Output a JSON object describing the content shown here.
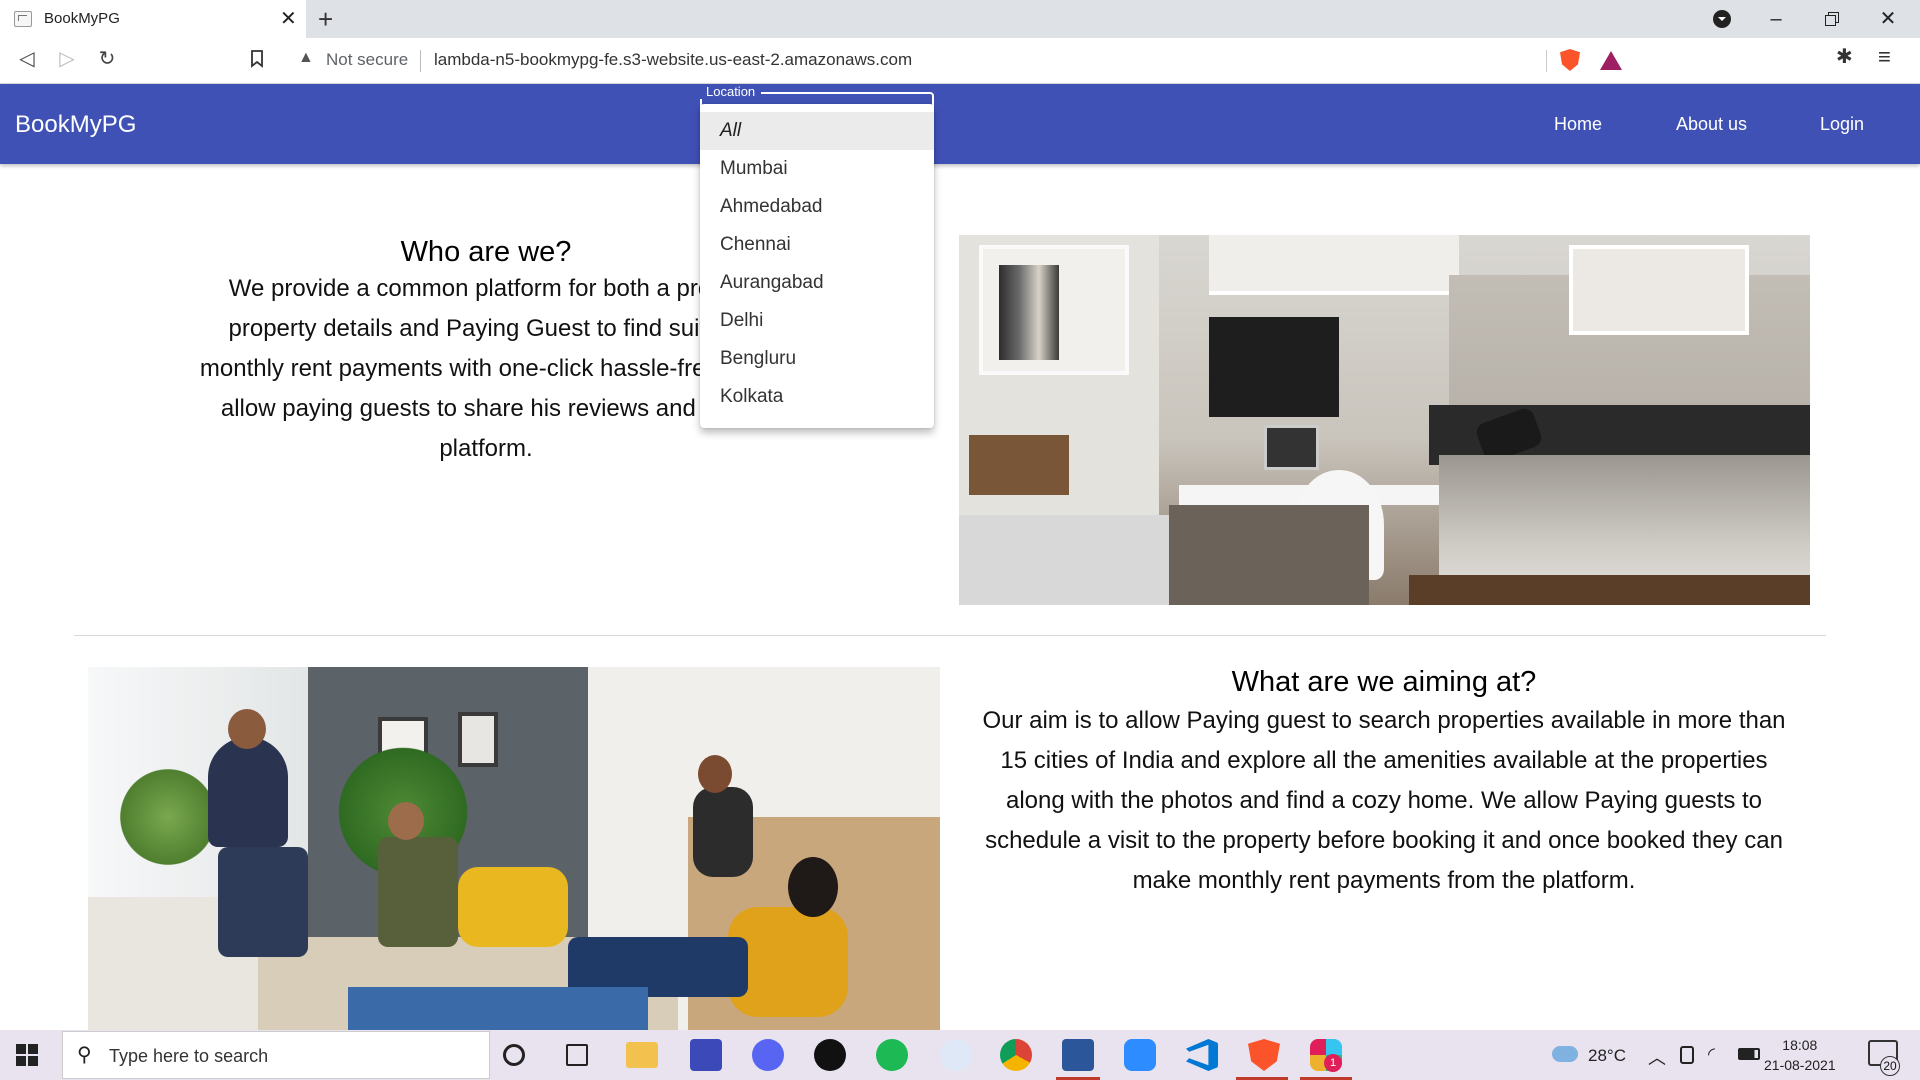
{
  "browser": {
    "tab_title": "BookMyPG",
    "security_label": "Not secure",
    "url": "lambda-n5-bookmypg-fe.s3-website.us-east-2.amazonaws.com"
  },
  "app": {
    "brand": "BookMyPG",
    "nav": [
      "Home",
      "About us",
      "Login"
    ]
  },
  "location_select": {
    "label": "Location",
    "selected": "All",
    "options": [
      "All",
      "Mumbai",
      "Ahmedabad",
      "Chennai",
      "Aurangabad",
      "Delhi",
      "Bengluru",
      "Kolkata"
    ]
  },
  "who": {
    "title": "Who are we?",
    "lines": [
      "We provide a common platform for both a property c",
      "property details and Paying Guest to find suitable p",
      "monthly rent payments with one-click hassle-free payr",
      "allow paying guests to share his reviews and raise c",
      "platform."
    ]
  },
  "aim": {
    "title": "What are we aiming at?",
    "lines": [
      "Our aim is to allow Paying guest to search properties available in more than",
      "15 cities of India and explore all the amenities available at the properties",
      "along with the photos and find a cozy home. We allow Paying guests to",
      "schedule a visit to the property before booking it and once booked they can",
      "make monthly rent payments from the platform."
    ]
  },
  "taskbar": {
    "search_placeholder": "Type here to search",
    "temperature": "28°C",
    "time": "18:08",
    "date": "21-08-2021",
    "notification_count": "20",
    "slack_badge": "1",
    "pinned_apps": [
      "cortana-icon",
      "task-view-icon",
      "file-explorer-icon",
      "pen-app-icon",
      "discord-icon",
      "xbox-icon",
      "spotify-icon",
      "app-icon",
      "chrome-icon",
      "word-icon",
      "zoom-icon",
      "vscode-icon",
      "brave-icon",
      "slack-icon"
    ]
  }
}
